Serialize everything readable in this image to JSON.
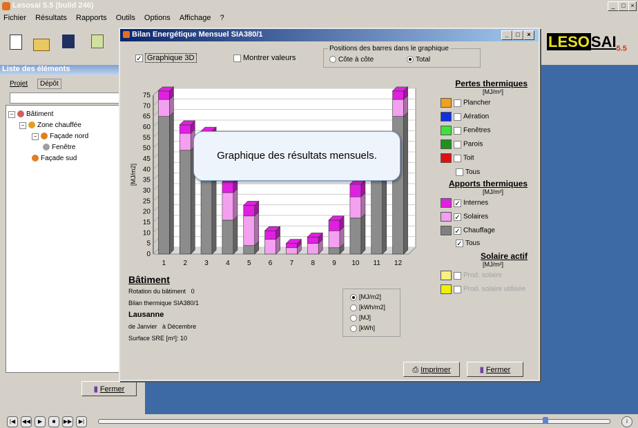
{
  "app": {
    "title": "Lesosai 5.5 (build 246)"
  },
  "menu": [
    "Fichier",
    "Résultats",
    "Rapports",
    "Outils",
    "Options",
    "Affichage",
    "?"
  ],
  "logo": {
    "text_a": "LESO",
    "text_b": "SAI",
    "version": "5.5"
  },
  "left": {
    "title": "Liste des éléments",
    "tabs": [
      "Projet",
      "Dépôt"
    ],
    "tree": [
      {
        "label": "Bâtiment",
        "expander": "−",
        "icon_color": "#d06060"
      },
      {
        "label": "Zone chauffée",
        "expander": "−",
        "icon_color": "#e0a020"
      },
      {
        "label": "Façade nord",
        "expander": "−",
        "icon_color": "#e08020"
      },
      {
        "label": "Fenêtre",
        "expander": "",
        "icon_color": "#a0a0a0"
      },
      {
        "label": "Façade sud",
        "expander": "",
        "icon_color": "#e08020"
      }
    ],
    "close_label": "Fermer"
  },
  "dialog": {
    "title": "Bilan Energétique Mensuel  SIA380/1",
    "graph3d_label": "Graphique 3D",
    "show_values_label": "Montrer valeurs",
    "bar_position_title": "Positions des barres dans le graphique",
    "side_by_side_label": "Côte à côte",
    "total_label": "Total",
    "units": [
      "[MJ/m2]",
      "[kWh/m2]",
      "[MJ]",
      "[kWh]"
    ],
    "info": {
      "heading": "Bâtiment",
      "rotation": "Rotation du bâtiment",
      "rotation_value": "0",
      "bilan": "Bilan thermique  SIA380/1",
      "city": "Lausanne",
      "from": "de Janvier",
      "to": "à Décembre",
      "sre": "Surface SRE [m²]:",
      "sre_value": "10"
    },
    "losses": {
      "heading": "Pertes thermiques",
      "unit": "[MJ/m²]",
      "items": [
        {
          "label": "Plancher",
          "color": "#f0a020"
        },
        {
          "label": "Aération",
          "color": "#1030e0"
        },
        {
          "label": "Fenêtres",
          "color": "#40e040"
        },
        {
          "label": "Parois",
          "color": "#209020"
        },
        {
          "label": "Toit",
          "color": "#e01010"
        }
      ],
      "all_label": "Tous"
    },
    "gains": {
      "heading": "Apports thermiques",
      "unit": "[MJ/m²]",
      "items": [
        {
          "label": "Internes",
          "color": "#e020e0"
        },
        {
          "label": "Solaires",
          "color": "#f0a0f0"
        },
        {
          "label": "Chauffage",
          "color": "#808080"
        }
      ],
      "all_label": "Tous"
    },
    "solar": {
      "heading": "Solaire actif",
      "unit": "[MJ/m²]",
      "items": [
        {
          "label": "Prod. solaire",
          "color": "#f8f080"
        },
        {
          "label": "Prod. solaire utilisée",
          "color": "#f0f000"
        }
      ]
    },
    "print_label": "Imprimer",
    "close_label": "Fermer"
  },
  "callout": "Graphique des résultats mensuels.",
  "chart_data": {
    "type": "bar",
    "categories": [
      "1",
      "2",
      "3",
      "4",
      "5",
      "6",
      "7",
      "8",
      "9",
      "10",
      "11",
      "12"
    ],
    "series": [
      {
        "name": "Chauffage",
        "values": [
          65,
          49,
          48,
          16,
          4,
          0,
          0,
          0,
          3,
          17,
          45,
          65
        ],
        "color": "#8c8c8c"
      },
      {
        "name": "Solaires",
        "values": [
          8,
          8,
          6,
          13,
          14,
          7,
          3,
          5,
          8,
          10,
          6,
          8
        ],
        "color": "#f4a0f0"
      },
      {
        "name": "Internes",
        "values": [
          4,
          4,
          4,
          5,
          5,
          4,
          2,
          3,
          5,
          6,
          4,
          4
        ],
        "color": "#e020e0"
      }
    ],
    "ylabel": "[MJ/m2]",
    "ylim": [
      0,
      75
    ],
    "yticks": [
      0,
      5,
      10,
      15,
      20,
      25,
      30,
      35,
      40,
      45,
      50,
      55,
      60,
      65,
      70,
      75
    ],
    "stacked": true,
    "grid": true
  }
}
